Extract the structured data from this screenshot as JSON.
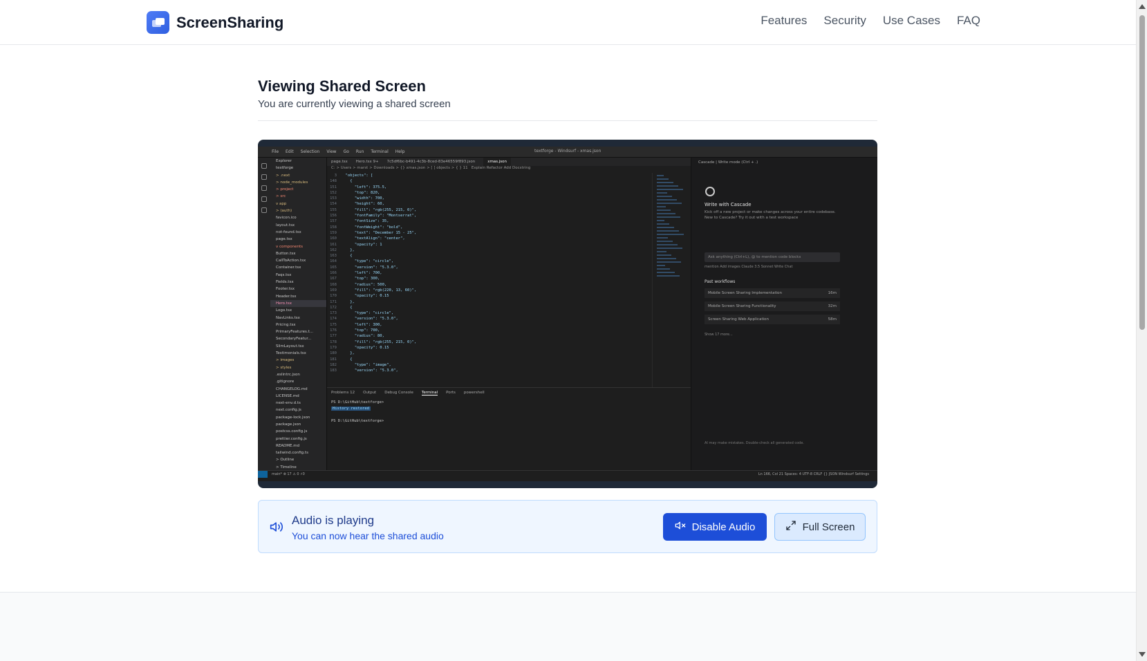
{
  "brand": {
    "name": "ScreenSharing",
    "logo_icon": "screens-icon",
    "accent": "#2f5fe0"
  },
  "nav": {
    "items": [
      "Features",
      "Security",
      "Use Cases",
      "FAQ"
    ]
  },
  "main": {
    "title": "Viewing Shared Screen",
    "subtitle": "You are currently viewing a shared screen"
  },
  "shared": {
    "menu": [
      "File",
      "Edit",
      "Selection",
      "View",
      "Go",
      "Run",
      "Terminal",
      "Help"
    ],
    "search": "textforge - Windsurf - xmas.json",
    "tabs": [
      "page.tsx",
      "Hero.tsx 9+",
      "7c5df6bc-b491-4c3b-8ced-83e46559f893.json",
      "xmas.json"
    ],
    "active_tab": "xmas.json",
    "breadcrumb": "C: > Users > marst > Downloads > {} xmas.json > [ ] objects > { } 11",
    "breadcrumb_actions": "Explain  Refactor  Add Docstring",
    "explorer": [
      {
        "t": "Explorer",
        "c": ""
      },
      {
        "t": "textforge",
        "c": ""
      },
      {
        "t": "> .next",
        "c": "folder"
      },
      {
        "t": "> node_modules",
        "c": "folder"
      },
      {
        "t": "> project",
        "c": "comp"
      },
      {
        "t": "> src",
        "c": "comp"
      },
      {
        "t": "  v app",
        "c": "folder"
      },
      {
        "t": "    > (auth)",
        "c": "folder"
      },
      {
        "t": "    favicon.ico",
        "c": ""
      },
      {
        "t": "    layout.tsx",
        "c": ""
      },
      {
        "t": "    not-found.tsx",
        "c": ""
      },
      {
        "t": "    page.tsx",
        "c": ""
      },
      {
        "t": "  v components",
        "c": "comp"
      },
      {
        "t": "    Button.tsx",
        "c": ""
      },
      {
        "t": "    CallToAction.tsx",
        "c": ""
      },
      {
        "t": "    Container.tsx",
        "c": ""
      },
      {
        "t": "    Faqs.tsx",
        "c": ""
      },
      {
        "t": "    Fields.tsx",
        "c": ""
      },
      {
        "t": "    Footer.tsx",
        "c": ""
      },
      {
        "t": "    Header.tsx",
        "c": ""
      },
      {
        "t": "    Hero.tsx",
        "c": "sel"
      },
      {
        "t": "    Logo.tsx",
        "c": ""
      },
      {
        "t": "    NavLinks.tsx",
        "c": ""
      },
      {
        "t": "    Pricing.tsx",
        "c": ""
      },
      {
        "t": "    PrimaryFeatures.t...",
        "c": ""
      },
      {
        "t": "    SecondaryFeatur...",
        "c": ""
      },
      {
        "t": "    SlimLayout.tsx",
        "c": ""
      },
      {
        "t": "    Testimonials.tsx",
        "c": ""
      },
      {
        "t": "  > images",
        "c": "folder"
      },
      {
        "t": "  > styles",
        "c": "folder"
      },
      {
        "t": "  .eslintrc.json",
        "c": ""
      },
      {
        "t": "  .gitignore",
        "c": ""
      },
      {
        "t": "  CHANGELOG.md",
        "c": ""
      },
      {
        "t": "  LICENSE.md",
        "c": ""
      },
      {
        "t": "  next-env.d.ts",
        "c": ""
      },
      {
        "t": "  next.config.js",
        "c": ""
      },
      {
        "t": "  package-lock.json",
        "c": ""
      },
      {
        "t": "  package.json",
        "c": ""
      },
      {
        "t": "  postcss.config.js",
        "c": ""
      },
      {
        "t": "  prettier.config.js",
        "c": ""
      },
      {
        "t": "  README.md",
        "c": ""
      },
      {
        "t": "  tailwind.config.ts",
        "c": ""
      },
      {
        "t": "> Outline",
        "c": ""
      },
      {
        "t": "> Timeline",
        "c": ""
      }
    ],
    "code": [
      [
        "3",
        "  \"objects\": ["
      ],
      [
        "148",
        "    {"
      ],
      [
        "151",
        "      \"left\": 375.5,"
      ],
      [
        "152",
        "      \"top\": 820,"
      ],
      [
        "153",
        "      \"width\": 700,"
      ],
      [
        "154",
        "      \"height\": 60,"
      ],
      [
        "155",
        "      \"fill\": \"rgb(255, 215, 0)\","
      ],
      [
        "156",
        "      \"fontFamily\": \"Montserrat\","
      ],
      [
        "157",
        "      \"fontSize\": 35,"
      ],
      [
        "158",
        "      \"fontWeight\": \"bold\","
      ],
      [
        "159",
        "      \"text\": \"December 15 - 25\","
      ],
      [
        "160",
        "      \"textAlign\": \"center\","
      ],
      [
        "161",
        "      \"opacity\": 1"
      ],
      [
        "162",
        "    },"
      ],
      [
        "163",
        "    {"
      ],
      [
        "164",
        "      \"type\": \"circle\","
      ],
      [
        "165",
        "      \"version\": \"5.3.0\","
      ],
      [
        "166",
        "      \"left\": 700,"
      ],
      [
        "167",
        "      \"top\": 300,"
      ],
      [
        "168",
        "      \"radius\": 500,"
      ],
      [
        "169",
        "      \"fill\": \"rgb(220, 13, 60)\","
      ],
      [
        "170",
        "      \"opacity\": 0.15"
      ],
      [
        "171",
        "    },"
      ],
      [
        "172",
        "    {"
      ],
      [
        "173",
        "      \"type\": \"circle\","
      ],
      [
        "174",
        "      \"version\": \"5.3.0\","
      ],
      [
        "175",
        "      \"left\": 300,"
      ],
      [
        "176",
        "      \"top\": 700,"
      ],
      [
        "177",
        "      \"radius\": 80,"
      ],
      [
        "178",
        "      \"fill\": \"rgb(255, 215, 0)\","
      ],
      [
        "179",
        "      \"opacity\": 0.15"
      ],
      [
        "180",
        "    },"
      ],
      [
        "181",
        "    {"
      ],
      [
        "182",
        "      \"type\": \"image\","
      ],
      [
        "183",
        "      \"version\": \"5.3.0\","
      ]
    ],
    "panel_tabs": [
      "Problems 12",
      "Output",
      "Debug Console",
      "Terminal",
      "Ports"
    ],
    "panel_right": "powershell",
    "terminal": [
      "PS D:\\GitHub\\textforge>",
      "History restored",
      "",
      "PS D:\\GitHub\\textforge>"
    ],
    "chat": {
      "header": "Cascade | Write mode (Ctrl + .)",
      "title": "Write with Cascade",
      "desc": "Kick off a new project or make changes across your entire codebase. New to Cascade? Try it out with a test workspace",
      "input_placeholder": "Ask anything (Ctrl+L), @ to mention code blocks",
      "sub": "mention   Add images   Claude 3.5 Sonnet        Write      Chat",
      "past_title": "Past workflows",
      "past": [
        {
          "name": "Mobile Screen Sharing Implementation",
          "time": "16m"
        },
        {
          "name": "Mobile Screen Sharing Functionality",
          "time": "32m"
        },
        {
          "name": "Screen Sharing Web Application",
          "time": "58m"
        }
      ],
      "show_more": "Show 17 more...",
      "footer": "AI may make mistakes. Double-check all generated code."
    },
    "status_left": "main*   ⊗ 17 ⚠ 0   ⚡0",
    "status_right": "Ln 166, Col 21   Spaces: 4   UTF-8   CRLF   {} JSON   Windsurf Settings"
  },
  "audio": {
    "title": "Audio is playing",
    "subtitle": "You can now hear the shared audio",
    "disable_label": "Disable Audio",
    "fullscreen_label": "Full Screen"
  }
}
